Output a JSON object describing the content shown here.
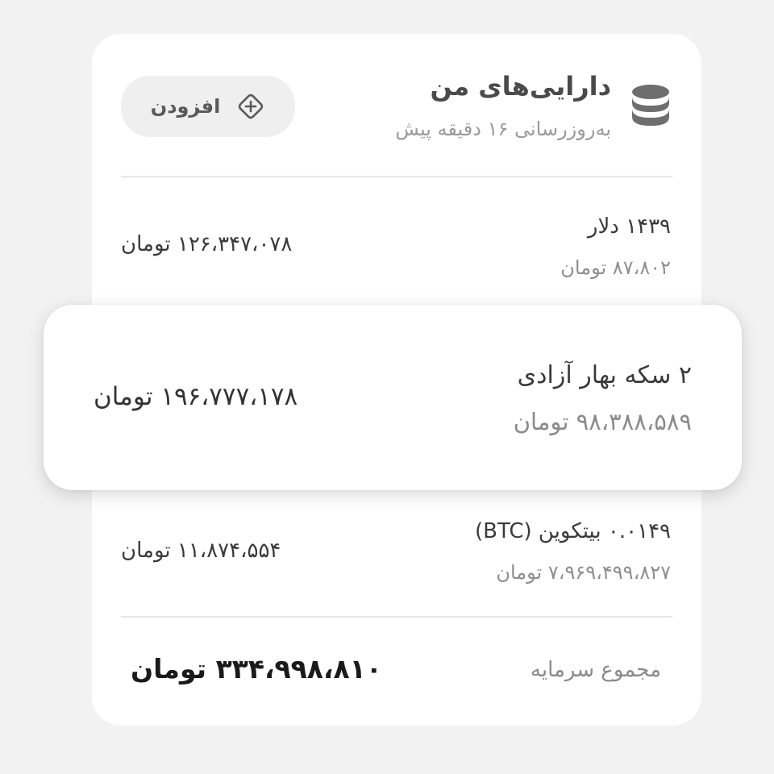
{
  "header": {
    "title": "دارایی‌های من",
    "subtitle": "به‌روزرسانی ۱۶ دقیقه پیش",
    "add_label": "افزودن",
    "icon": "database-icon"
  },
  "assets": [
    {
      "name": "۱۴۳۹ دلار",
      "price": "۸۷،۸۰۲ تومان",
      "value": "۱۲۶،۳۴۷،۰۷۸ تومان"
    },
    {
      "name": "۲ سکه بهار آزادی",
      "price": "۹۸،۳۸۸،۵۸۹ تومان",
      "value": "۱۹۶،۷۷۷،۱۷۸ تومان"
    },
    {
      "name": "۰.۰۱۴۹ بیتکوین (BTC)",
      "price": "۷،۹۶۹،۴۹۹،۸۲۷ تومان",
      "value": "۱۱،۸۷۴،۵۵۴ تومان"
    }
  ],
  "total": {
    "label": "مجموع سرمایه",
    "value": "۳۳۴،۹۹۸،۸۱۰ تومان"
  },
  "colors": {
    "background": "#f2f2f2",
    "card": "#ffffff",
    "icon": "#6e6e6e"
  }
}
